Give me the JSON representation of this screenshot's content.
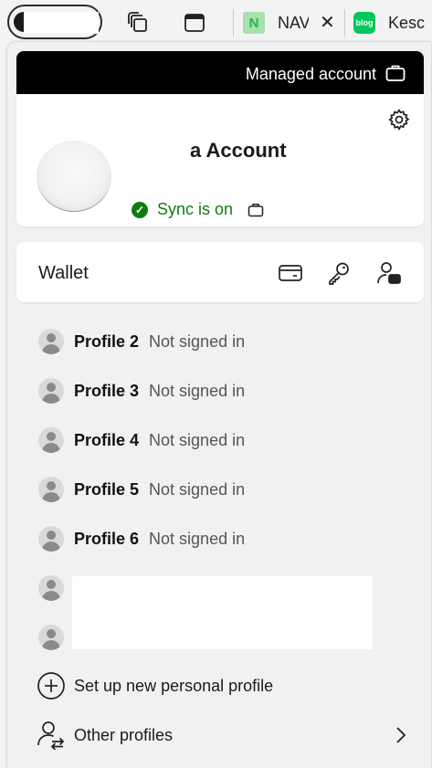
{
  "tabs": [
    {
      "title": "NAV",
      "favicon_text": "N",
      "favicon_color": "#a8e0b0",
      "favicon_text_color": "#2fb34a",
      "has_close": true,
      "close_symbol": "✕"
    },
    {
      "title": "Kesc",
      "favicon_text": "blog",
      "favicon_color": "#03c75a",
      "favicon_text_color": "#ffffff"
    }
  ],
  "toolbar_icons": [
    "workspaces-icon",
    "tab-actions-icon"
  ],
  "account": {
    "managed_label": "Managed account",
    "name": "a Account",
    "sync_text": "Sync is on",
    "sync_color": "#107c10"
  },
  "wallet": {
    "label": "Wallet",
    "icons": [
      "payment-card-icon",
      "password-key-icon",
      "personal-info-icon"
    ]
  },
  "profiles": [
    {
      "name": "Profile 2",
      "status": "Not signed in"
    },
    {
      "name": "Profile 3",
      "status": "Not signed in"
    },
    {
      "name": "Profile 4",
      "status": "Not signed in"
    },
    {
      "name": "Profile 5",
      "status": "Not signed in"
    },
    {
      "name": "Profile 6",
      "status": "Not signed in"
    },
    {
      "name": "",
      "status": ""
    },
    {
      "name": "",
      "status": ""
    }
  ],
  "actions": {
    "new_profile": "Set up new personal profile",
    "other_profiles": "Other profiles"
  }
}
